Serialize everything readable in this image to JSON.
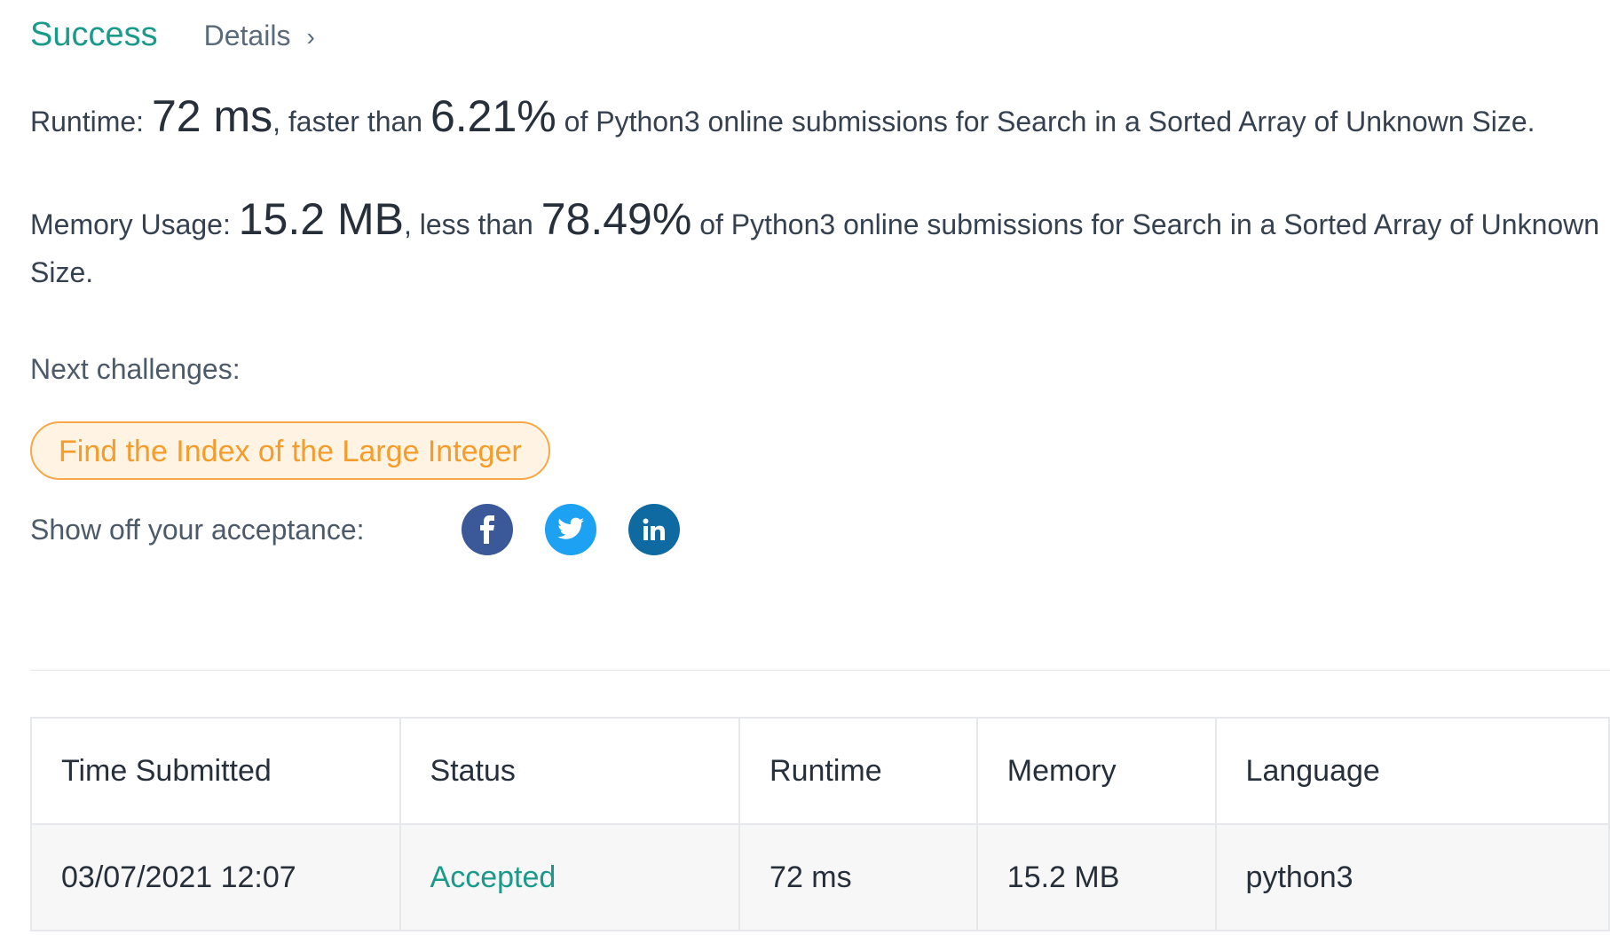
{
  "header": {
    "status": "Success",
    "details_label": "Details",
    "chevron_glyph": "›"
  },
  "runtime": {
    "label": "Runtime:",
    "value": "72 ms",
    "comparison_text": ", faster than",
    "percent": "6.21%",
    "suffix": " of Python3 online submissions for Search in a Sorted Array of Unknown Size."
  },
  "memory": {
    "label": "Memory Usage:",
    "value": "15.2 MB",
    "comparison_text": ", less than",
    "percent": "78.49%",
    "suffix": " of Python3 online submissions for Search in a Sorted Array of Unknown Size."
  },
  "next": {
    "label": "Next challenges:",
    "challenges": [
      "Find the Index of the Large Integer"
    ]
  },
  "share": {
    "label": "Show off your acceptance:",
    "icons": [
      "facebook-icon",
      "twitter-icon",
      "linkedin-icon"
    ],
    "colors": {
      "facebook": "#3b5998",
      "twitter": "#1da1f2",
      "linkedin": "#0e6aa0"
    }
  },
  "table": {
    "headers": [
      "Time Submitted",
      "Status",
      "Runtime",
      "Memory",
      "Language"
    ],
    "rows": [
      [
        "03/07/2021 12:07",
        "Accepted",
        "72 ms",
        "15.2 MB",
        "python3"
      ]
    ]
  },
  "colors": {
    "success": "#1a9a8a",
    "challenge_text": "#f59c2a",
    "challenge_bg": "#fff3e3"
  }
}
